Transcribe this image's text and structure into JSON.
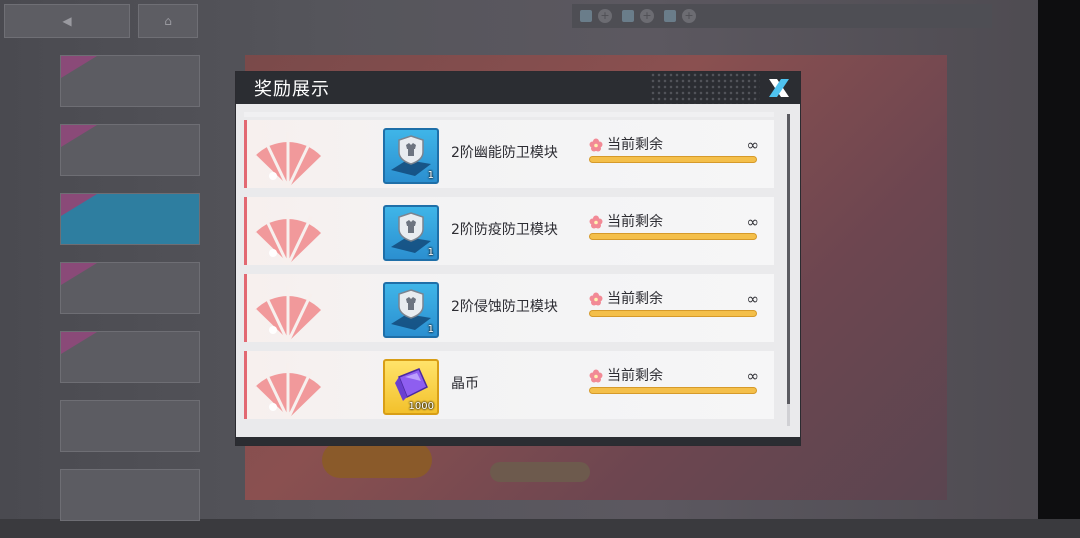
{
  "modal": {
    "title": "奖励展示",
    "rows": [
      {
        "name": "2阶幽能防卫模块",
        "count": "1",
        "icon": "defense-module-icon",
        "frame": "blue",
        "remain_label": "当前剩余",
        "remain_value": "∞",
        "remain_fill": 1.0
      },
      {
        "name": "2阶防疫防卫模块",
        "count": "1",
        "icon": "defense-module-icon",
        "frame": "blue",
        "remain_label": "当前剩余",
        "remain_value": "∞",
        "remain_fill": 1.0
      },
      {
        "name": "2阶侵蚀防卫模块",
        "count": "1",
        "icon": "defense-module-icon",
        "frame": "blue",
        "remain_label": "当前剩余",
        "remain_value": "∞",
        "remain_fill": 1.0
      },
      {
        "name": "晶币",
        "count": "1000",
        "icon": "crystal-coin-icon",
        "frame": "gold",
        "remain_label": "当前剩余",
        "remain_value": "∞",
        "remain_fill": 1.0
      }
    ]
  },
  "colors": {
    "header": "#2b2d32",
    "accent_red": "#e26872",
    "bar_fill": "#f4bf4a",
    "icon_blue": "#2b8fd0",
    "icon_gold": "#f3c12c"
  }
}
